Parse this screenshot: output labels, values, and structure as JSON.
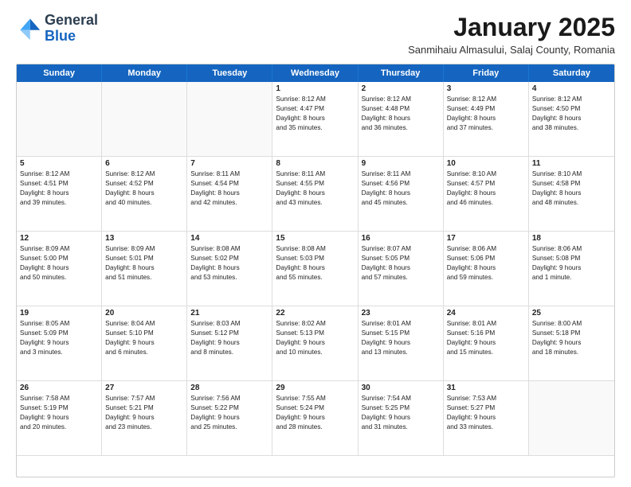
{
  "header": {
    "logo": {
      "line1": "General",
      "line2": "Blue"
    },
    "title": "January 2025",
    "subtitle": "Sanmihaiu Almasului, Salaj County, Romania"
  },
  "days_of_week": [
    "Sunday",
    "Monday",
    "Tuesday",
    "Wednesday",
    "Thursday",
    "Friday",
    "Saturday"
  ],
  "weeks": [
    [
      {
        "day": "",
        "empty": true,
        "text": ""
      },
      {
        "day": "",
        "empty": true,
        "text": ""
      },
      {
        "day": "",
        "empty": true,
        "text": ""
      },
      {
        "day": "1",
        "text": "Sunrise: 8:12 AM\nSunset: 4:47 PM\nDaylight: 8 hours\nand 35 minutes."
      },
      {
        "day": "2",
        "text": "Sunrise: 8:12 AM\nSunset: 4:48 PM\nDaylight: 8 hours\nand 36 minutes."
      },
      {
        "day": "3",
        "text": "Sunrise: 8:12 AM\nSunset: 4:49 PM\nDaylight: 8 hours\nand 37 minutes."
      },
      {
        "day": "4",
        "text": "Sunrise: 8:12 AM\nSunset: 4:50 PM\nDaylight: 8 hours\nand 38 minutes."
      }
    ],
    [
      {
        "day": "5",
        "text": "Sunrise: 8:12 AM\nSunset: 4:51 PM\nDaylight: 8 hours\nand 39 minutes."
      },
      {
        "day": "6",
        "text": "Sunrise: 8:12 AM\nSunset: 4:52 PM\nDaylight: 8 hours\nand 40 minutes."
      },
      {
        "day": "7",
        "text": "Sunrise: 8:11 AM\nSunset: 4:54 PM\nDaylight: 8 hours\nand 42 minutes."
      },
      {
        "day": "8",
        "text": "Sunrise: 8:11 AM\nSunset: 4:55 PM\nDaylight: 8 hours\nand 43 minutes."
      },
      {
        "day": "9",
        "text": "Sunrise: 8:11 AM\nSunset: 4:56 PM\nDaylight: 8 hours\nand 45 minutes."
      },
      {
        "day": "10",
        "text": "Sunrise: 8:10 AM\nSunset: 4:57 PM\nDaylight: 8 hours\nand 46 minutes."
      },
      {
        "day": "11",
        "text": "Sunrise: 8:10 AM\nSunset: 4:58 PM\nDaylight: 8 hours\nand 48 minutes."
      }
    ],
    [
      {
        "day": "12",
        "text": "Sunrise: 8:09 AM\nSunset: 5:00 PM\nDaylight: 8 hours\nand 50 minutes."
      },
      {
        "day": "13",
        "text": "Sunrise: 8:09 AM\nSunset: 5:01 PM\nDaylight: 8 hours\nand 51 minutes."
      },
      {
        "day": "14",
        "text": "Sunrise: 8:08 AM\nSunset: 5:02 PM\nDaylight: 8 hours\nand 53 minutes."
      },
      {
        "day": "15",
        "text": "Sunrise: 8:08 AM\nSunset: 5:03 PM\nDaylight: 8 hours\nand 55 minutes."
      },
      {
        "day": "16",
        "text": "Sunrise: 8:07 AM\nSunset: 5:05 PM\nDaylight: 8 hours\nand 57 minutes."
      },
      {
        "day": "17",
        "text": "Sunrise: 8:06 AM\nSunset: 5:06 PM\nDaylight: 8 hours\nand 59 minutes."
      },
      {
        "day": "18",
        "text": "Sunrise: 8:06 AM\nSunset: 5:08 PM\nDaylight: 9 hours\nand 1 minute."
      }
    ],
    [
      {
        "day": "19",
        "text": "Sunrise: 8:05 AM\nSunset: 5:09 PM\nDaylight: 9 hours\nand 3 minutes."
      },
      {
        "day": "20",
        "text": "Sunrise: 8:04 AM\nSunset: 5:10 PM\nDaylight: 9 hours\nand 6 minutes."
      },
      {
        "day": "21",
        "text": "Sunrise: 8:03 AM\nSunset: 5:12 PM\nDaylight: 9 hours\nand 8 minutes."
      },
      {
        "day": "22",
        "text": "Sunrise: 8:02 AM\nSunset: 5:13 PM\nDaylight: 9 hours\nand 10 minutes."
      },
      {
        "day": "23",
        "text": "Sunrise: 8:01 AM\nSunset: 5:15 PM\nDaylight: 9 hours\nand 13 minutes."
      },
      {
        "day": "24",
        "text": "Sunrise: 8:01 AM\nSunset: 5:16 PM\nDaylight: 9 hours\nand 15 minutes."
      },
      {
        "day": "25",
        "text": "Sunrise: 8:00 AM\nSunset: 5:18 PM\nDaylight: 9 hours\nand 18 minutes."
      }
    ],
    [
      {
        "day": "26",
        "text": "Sunrise: 7:58 AM\nSunset: 5:19 PM\nDaylight: 9 hours\nand 20 minutes."
      },
      {
        "day": "27",
        "text": "Sunrise: 7:57 AM\nSunset: 5:21 PM\nDaylight: 9 hours\nand 23 minutes."
      },
      {
        "day": "28",
        "text": "Sunrise: 7:56 AM\nSunset: 5:22 PM\nDaylight: 9 hours\nand 25 minutes."
      },
      {
        "day": "29",
        "text": "Sunrise: 7:55 AM\nSunset: 5:24 PM\nDaylight: 9 hours\nand 28 minutes."
      },
      {
        "day": "30",
        "text": "Sunrise: 7:54 AM\nSunset: 5:25 PM\nDaylight: 9 hours\nand 31 minutes."
      },
      {
        "day": "31",
        "text": "Sunrise: 7:53 AM\nSunset: 5:27 PM\nDaylight: 9 hours\nand 33 minutes."
      },
      {
        "day": "",
        "empty": true,
        "text": ""
      }
    ]
  ]
}
